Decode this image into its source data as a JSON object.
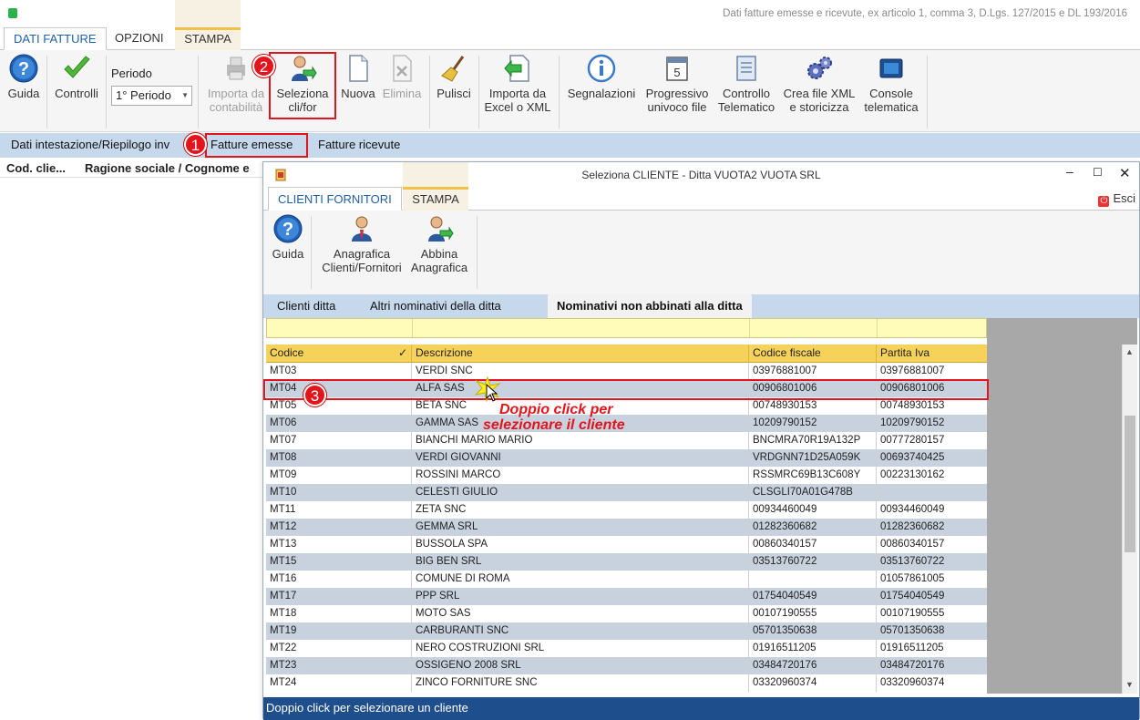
{
  "window": {
    "title": "Dati fatture emesse e ricevute, ex articolo 1, comma 3, D.Lgs. 127/2015 e DL 193/2016"
  },
  "tabs": [
    "DATI FATTURE",
    "OPZIONI",
    "STAMPA"
  ],
  "ribbon": {
    "guida": "Guida",
    "controlli": "Controlli",
    "periodo_label": "Periodo",
    "periodo_value": "1° Periodo",
    "importa_contabilita": "Importa da contabilità",
    "seleziona": "Seleziona cli/for",
    "nuova": "Nuova",
    "elimina": "Elimina",
    "pulisci": "Pulisci",
    "importa_excel": "Importa da Excel o XML",
    "segnalazioni": "Segnalazioni",
    "progressivo": "Progressivo univoco file",
    "controllo_telematico": "Controllo Telematico",
    "crea_xml": "Crea file XML e storicizza",
    "console": "Console telematica"
  },
  "subtabs": [
    "Dati intestazione/Riepilogo inv",
    "Fatture emesse",
    "Fatture ricevute"
  ],
  "left_columns": [
    "Cod. clie...",
    "Ragione sociale / Cognome e"
  ],
  "dialog": {
    "title": "Seleziona CLIENTE  - Ditta VUOTA2 VUOTA SRL",
    "tabs": [
      "CLIENTI FORNITORI",
      "STAMPA"
    ],
    "esci": "Esci",
    "ribbon": {
      "guida": "Guida",
      "anagrafica": "Anagrafica Clienti/Fornitori",
      "abbina": "Abbina Anagrafica"
    },
    "subtabs": [
      "Clienti ditta",
      "Altri nominativi della ditta",
      "Nominativi non abbinati alla ditta"
    ],
    "columns": [
      "Codice",
      "Descrizione",
      "Codice fiscale",
      "Partita Iva"
    ],
    "sort_mark": "✓",
    "rows": [
      [
        "MT03",
        "VERDI SNC",
        "03976881007",
        "03976881007"
      ],
      [
        "MT04",
        "ALFA SAS",
        "00906801006",
        "00906801006"
      ],
      [
        "MT05",
        "BETA SNC",
        "00748930153",
        "00748930153"
      ],
      [
        "MT06",
        "GAMMA SAS",
        "10209790152",
        "10209790152"
      ],
      [
        "MT07",
        "BIANCHI MARIO MARIO",
        "BNCMRA70R19A132P",
        "00777280157"
      ],
      [
        "MT08",
        "VERDI GIOVANNI",
        "VRDGNN71D25A059K",
        "00693740425"
      ],
      [
        "MT09",
        "ROSSINI MARCO",
        "RSSMRC69B13C608Y",
        "00223130162"
      ],
      [
        "MT10",
        "CELESTI GIULIO",
        "CLSGLI70A01G478B",
        ""
      ],
      [
        "MT11",
        "ZETA SNC",
        "00934460049",
        "00934460049"
      ],
      [
        "MT12",
        "GEMMA SRL",
        "01282360682",
        "01282360682"
      ],
      [
        "MT13",
        "BUSSOLA SPA",
        "00860340157",
        "00860340157"
      ],
      [
        "MT15",
        "BIG BEN SRL",
        "03513760722",
        "03513760722"
      ],
      [
        "MT16",
        "COMUNE DI ROMA",
        "",
        "01057861005"
      ],
      [
        "MT17",
        "PPP SRL",
        "01754040549",
        "01754040549"
      ],
      [
        "MT18",
        "MOTO SAS",
        "00107190555",
        "00107190555"
      ],
      [
        "MT19",
        "CARBURANTI SNC",
        "05701350638",
        "05701350638"
      ],
      [
        "MT22",
        "NERO COSTRUZIONI SRL",
        "01916511205",
        "01916511205"
      ],
      [
        "MT23",
        "OSSIGENO 2008 SRL",
        "03484720176",
        "03484720176"
      ],
      [
        "MT24",
        "ZINCO FORNITURE SNC",
        "03320960374",
        "03320960374"
      ]
    ],
    "status": "Doppio click per selezionare un cliente"
  },
  "annotations": {
    "badge1": "1",
    "badge2": "2",
    "badge3": "3",
    "callout": "Doppio click per selezionare il cliente"
  },
  "colors": {
    "accent": "#2160a6",
    "highlight": "#e3141b",
    "grid_header": "#f7d25a",
    "status_bar": "#1f4e8c"
  }
}
